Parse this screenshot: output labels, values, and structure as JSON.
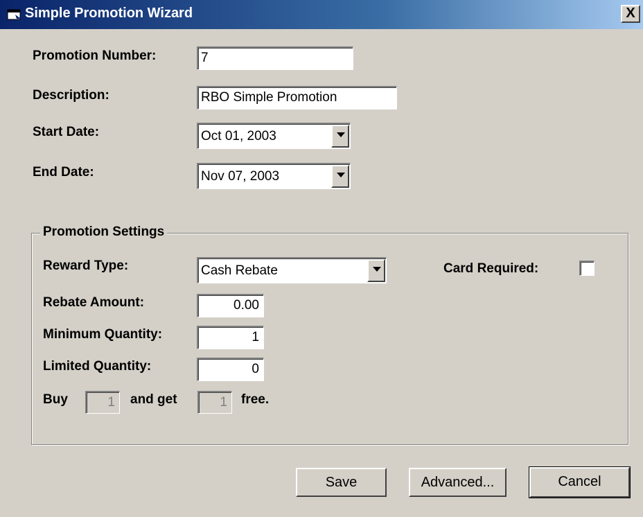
{
  "window": {
    "title": "Simple Promotion Wizard",
    "close_label": "X"
  },
  "form": {
    "promotion_number": {
      "label": "Promotion Number:",
      "value": "7"
    },
    "description": {
      "label": "Description:",
      "value": "RBO Simple Promotion"
    },
    "start_date": {
      "label": "Start Date:",
      "value": "Oct 01, 2003"
    },
    "end_date": {
      "label": "End Date:",
      "value": "Nov 07, 2003"
    }
  },
  "settings": {
    "legend": "Promotion Settings",
    "reward_type": {
      "label": "Reward Type:",
      "value": "Cash Rebate"
    },
    "card_required": {
      "label": "Card Required:",
      "checked": false
    },
    "rebate_amount": {
      "label": "Rebate Amount:",
      "value": "0.00"
    },
    "minimum_quantity": {
      "label": "Minimum Quantity:",
      "value": "1"
    },
    "limited_quantity": {
      "label": "Limited Quantity:",
      "value": "0"
    },
    "buy_get": {
      "buy_label": "Buy",
      "buy_value": "1",
      "and_get_label": "and get",
      "get_value": "1",
      "free_label": "free."
    }
  },
  "buttons": {
    "save": "Save",
    "advanced": "Advanced...",
    "cancel": "Cancel"
  }
}
